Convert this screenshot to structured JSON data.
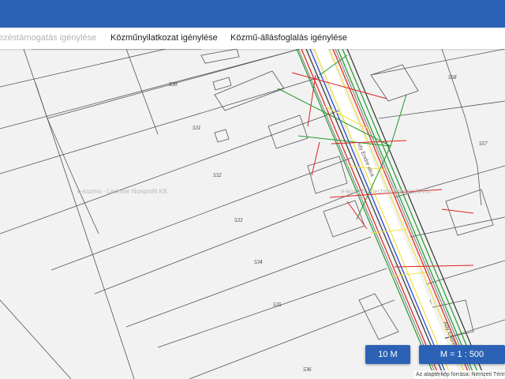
{
  "tabs": [
    {
      "label": "ezéstámogatás igénylése",
      "faded": true
    },
    {
      "label": "Közműnyilatkozat igénylése",
      "faded": false
    },
    {
      "label": "Közmű-állásfoglalás igénylése",
      "faded": false
    }
  ],
  "parcels": [
    "530",
    "531",
    "532",
    "533",
    "534",
    "535",
    "536",
    "557",
    "558"
  ],
  "watermarks": [
    "e-kozmu - Lechner Nonprofit Kft.",
    "e-kozmu - Lechner Nonprofit Kft."
  ],
  "street_name": "Ady Endre utca",
  "scale_buttons": {
    "distance": "10 M",
    "ratio": "M = 1 : 500"
  },
  "attribution": "Az alaptérkép forrása: Nemzeti Térinformatikai",
  "colors": {
    "header": "#2c62b5",
    "utility_red": "#e02020",
    "utility_green": "#1f9a2a",
    "utility_blue": "#1e3fd0",
    "utility_yellow": "#f0e040",
    "utility_dark": "#333333"
  }
}
